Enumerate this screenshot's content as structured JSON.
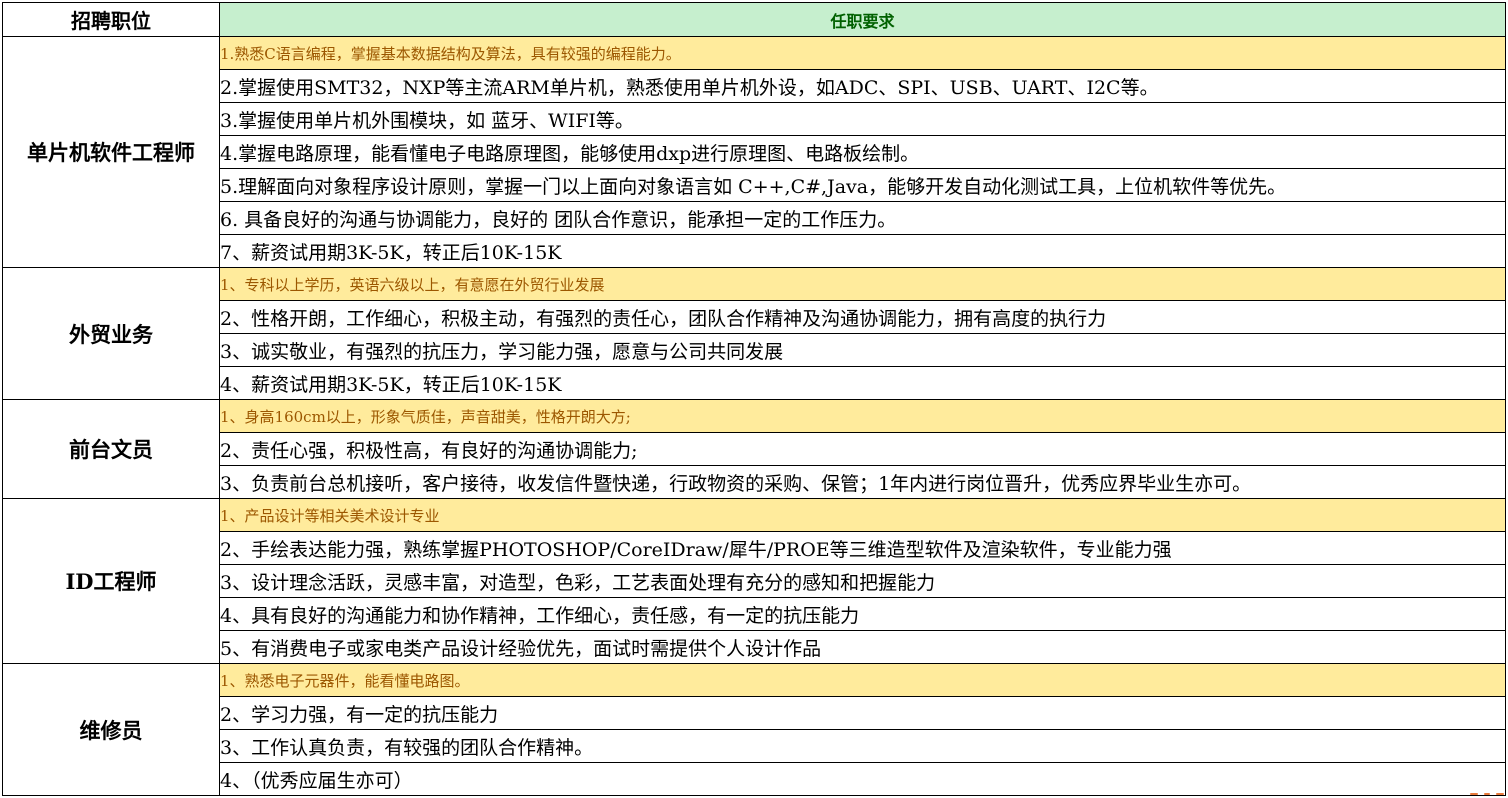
{
  "header": {
    "position_col": "招聘职位",
    "requirements_col": "任职要求"
  },
  "positions": [
    {
      "title": "单片机软件工程师",
      "requirements": [
        "1.熟悉C语言编程，掌握基本数据结构及算法，具有较强的编程能力。",
        "2.掌握使用SMT32，NXP等主流ARM单片机，熟悉使用单片机外设，如ADC、SPI、USB、UART、I2C等。",
        "3.掌握使用单片机外围模块，如 蓝牙、WIFI等。",
        "4.掌握电路原理，能看懂电子电路原理图，能够使用dxp进行原理图、电路板绘制。",
        "5.理解面向对象程序设计原则，掌握一门以上面向对象语言如 C++,C#,Java，能够开发自动化测试工具，上位机软件等优先。",
        "6. 具备良好的沟通与协调能力，良好的 团队合作意识，能承担一定的工作压力。",
        "7、薪资试用期3K-5K，转正后10K-15K"
      ]
    },
    {
      "title": "外贸业务",
      "requirements": [
        "1、专科以上学历，英语六级以上，有意愿在外贸行业发展",
        "2、性格开朗，工作细心，积极主动，有强烈的责任心，团队合作精神及沟通协调能力，拥有高度的执行力",
        "3、诚实敬业，有强烈的抗压力，学习能力强，愿意与公司共同发展",
        "4、薪资试用期3K-5K，转正后10K-15K"
      ]
    },
    {
      "title": "前台文员",
      "requirements": [
        "1、身高160cm以上，形象气质佳，声音甜美，性格开朗大方;",
        "2、责任心强，积极性高，有良好的沟通协调能力;",
        "3、负责前台总机接听，客户接待，收发信件暨快递，行政物资的采购、保管；1年内进行岗位晋升，优秀应界毕业生亦可。"
      ]
    },
    {
      "title": "ID工程师",
      "requirements": [
        "1、产品设计等相关美术设计专业",
        "2、手绘表达能力强，熟练掌握PHOTOSHOP/CoreIDraw/犀牛/PROE等三维造型软件及渲染软件，专业能力强",
        "3、设计理念活跃，灵感丰富，对造型，色彩，工艺表面处理有充分的感知和把握能力",
        "4、具有良好的沟通能力和协作精神，工作细心，责任感，有一定的抗压能力",
        "5、有消费电子或家电类产品设计经验优先，面试时需提供个人设计作品"
      ]
    },
    {
      "title": "维修员",
      "requirements": [
        "1、熟悉电子元器件，能看懂电路图。",
        "2、学习力强，有一定的抗压能力",
        "3、工作认真负责，有较强的团队合作精神。",
        "4、（优秀应届生亦可）"
      ]
    }
  ],
  "colors": {
    "header_req_bg": "#c6efce",
    "header_req_text": "#006100",
    "highlight_bg": "#ffeb9c",
    "highlight_text": "#9c5700",
    "grid": "#000000"
  }
}
